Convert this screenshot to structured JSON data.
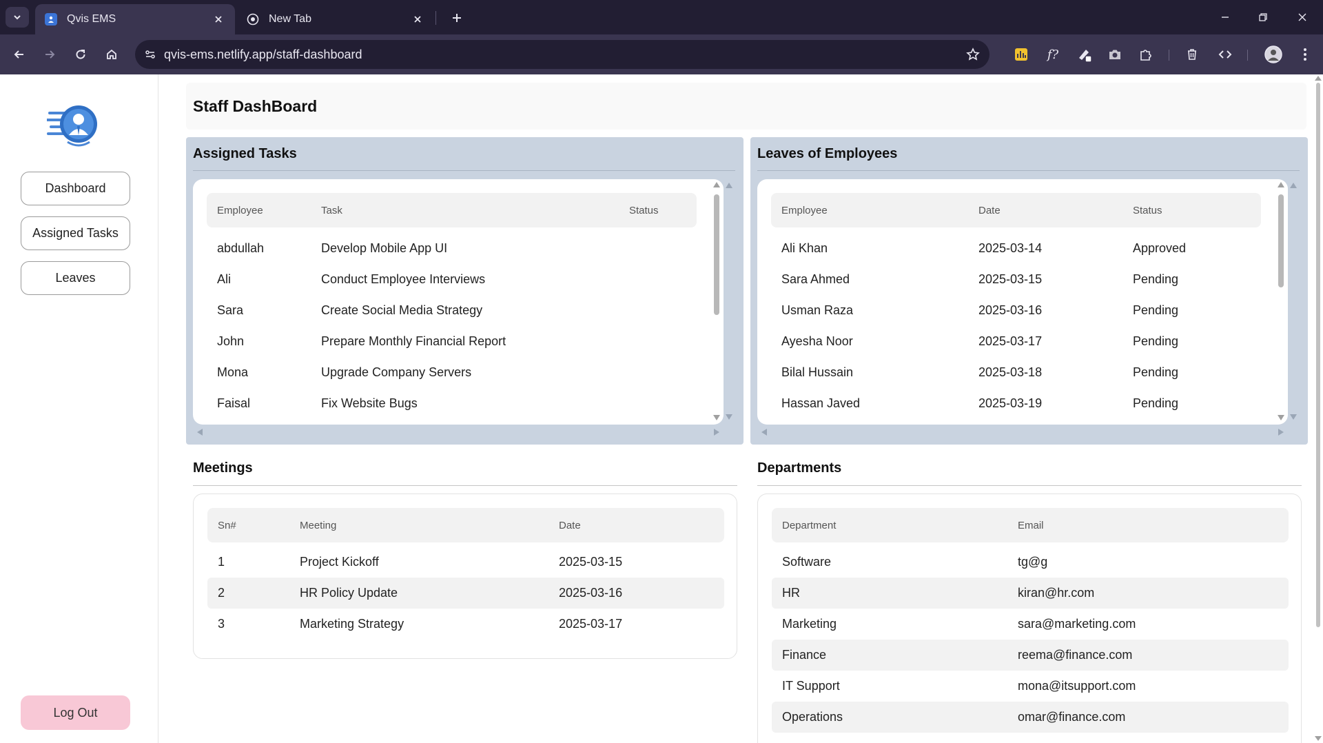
{
  "browser": {
    "tabs": [
      {
        "title": "Qvis EMS",
        "active": true
      },
      {
        "title": "New Tab",
        "active": false
      }
    ],
    "url": "qvis-ems.netlify.app/staff-dashboard"
  },
  "sidebar": {
    "items": [
      {
        "label": "Dashboard"
      },
      {
        "label": "Assigned Tasks"
      },
      {
        "label": "Leaves"
      }
    ],
    "logout_label": "Log Out"
  },
  "header": {
    "title": "Staff DashBoard"
  },
  "assigned_tasks": {
    "title": "Assigned Tasks",
    "columns": [
      "Employee",
      "Task",
      "Status"
    ],
    "rows": [
      {
        "employee": "abdullah",
        "task": "Develop Mobile App UI",
        "status": ""
      },
      {
        "employee": "Ali",
        "task": "Conduct Employee Interviews",
        "status": ""
      },
      {
        "employee": "Sara",
        "task": "Create Social Media Strategy",
        "status": ""
      },
      {
        "employee": "John",
        "task": "Prepare Monthly Financial Report",
        "status": ""
      },
      {
        "employee": "Mona",
        "task": "Upgrade Company Servers",
        "status": ""
      },
      {
        "employee": "Faisal",
        "task": "Fix Website Bugs",
        "status": ""
      }
    ]
  },
  "leaves": {
    "title": "Leaves of Employees",
    "columns": [
      "Employee",
      "Date",
      "Status"
    ],
    "rows": [
      {
        "employee": "Ali Khan",
        "date": "2025-03-14",
        "status": "Approved"
      },
      {
        "employee": "Sara Ahmed",
        "date": "2025-03-15",
        "status": "Pending"
      },
      {
        "employee": "Usman Raza",
        "date": "2025-03-16",
        "status": "Pending"
      },
      {
        "employee": "Ayesha Noor",
        "date": "2025-03-17",
        "status": "Pending"
      },
      {
        "employee": "Bilal Hussain",
        "date": "2025-03-18",
        "status": "Pending"
      },
      {
        "employee": "Hassan Javed",
        "date": "2025-03-19",
        "status": "Pending"
      }
    ]
  },
  "meetings": {
    "title": "Meetings",
    "columns": [
      "Sn#",
      "Meeting",
      "Date"
    ],
    "rows": [
      {
        "sn": "1",
        "meeting": "Project Kickoff",
        "date": "2025-03-15"
      },
      {
        "sn": "2",
        "meeting": "HR Policy Update",
        "date": "2025-03-16"
      },
      {
        "sn": "3",
        "meeting": "Marketing Strategy",
        "date": "2025-03-17"
      }
    ]
  },
  "departments": {
    "title": "Departments",
    "columns": [
      "Department",
      "Email"
    ],
    "rows": [
      {
        "department": "Software",
        "email": "tg@g"
      },
      {
        "department": "HR",
        "email": "kiran@hr.com"
      },
      {
        "department": "Marketing",
        "email": "sara@marketing.com"
      },
      {
        "department": "Finance",
        "email": "reema@finance.com"
      },
      {
        "department": "IT Support",
        "email": "mona@itsupport.com"
      },
      {
        "department": "Operations",
        "email": "omar@finance.com"
      }
    ]
  },
  "colors": {
    "panel_bg": "#c9d3e0",
    "logout_bg": "#f8c8d6",
    "browser_frame": "#221e33",
    "browser_toolbar": "#3a3550",
    "logo_blue": "#2f6fc4"
  },
  "icons": {
    "tab_search": "chevron-down-icon",
    "tab_close": "close-icon",
    "new_tab": "plus-icon",
    "back": "arrow-left-icon",
    "forward": "arrow-right-icon",
    "reload": "reload-icon",
    "home": "home-icon",
    "site_info": "tune-icon",
    "bookmark": "star-icon",
    "logo": "staff-logo-icon"
  }
}
